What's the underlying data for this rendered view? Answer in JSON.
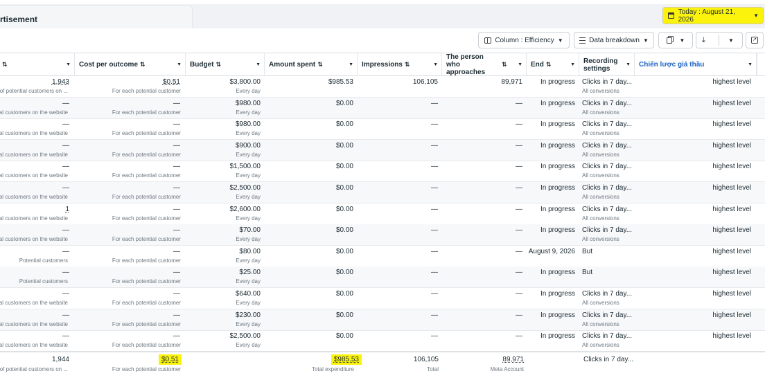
{
  "tab": {
    "title": "rtisement"
  },
  "date_button": {
    "label": "Today : August 21, 2026"
  },
  "toolbar": {
    "columns_label": "Column : Efficiency",
    "breakdown_label": "Data breakdown"
  },
  "headers": {
    "results": "",
    "cost_per_outcome": "Cost per outcome",
    "budget": "Budget",
    "amount_spent": "Amount spent",
    "impressions": "Impressions",
    "person_approaches": "The person who approaches",
    "end": "End",
    "recording": "Recording settings",
    "bid_strategy": "Chiến lược giá thầu"
  },
  "rows": [
    {
      "results": "1,943",
      "results_sub": "of potential customers on ...",
      "cpo": "$0.51",
      "cpo_sub": "For each potential customer",
      "budget": "$3,800.00",
      "budget_sub": "Every day",
      "spent": "$985.53",
      "impressions": "106,105",
      "approaches": "89,971",
      "end": "In progress",
      "recording": "Clicks in 7 day...",
      "recording_sub": "All conversions",
      "bid": "highest level"
    },
    {
      "results": "—",
      "results_sub": "al customers on the website",
      "cpo": "—",
      "cpo_sub": "For each potential customer",
      "budget": "$980.00",
      "budget_sub": "Every day",
      "spent": "$0.00",
      "impressions": "—",
      "approaches": "—",
      "end": "In progress",
      "recording": "Clicks in 7 day...",
      "recording_sub": "All conversions",
      "bid": "highest level"
    },
    {
      "results": "—",
      "results_sub": "al customers on the website",
      "cpo": "—",
      "cpo_sub": "For each potential customer",
      "budget": "$980.00",
      "budget_sub": "Every day",
      "spent": "$0.00",
      "impressions": "—",
      "approaches": "—",
      "end": "In progress",
      "recording": "Clicks in 7 day...",
      "recording_sub": "All conversions",
      "bid": "highest level"
    },
    {
      "results": "—",
      "results_sub": "al customers on the website",
      "cpo": "—",
      "cpo_sub": "For each potential customer",
      "budget": "$900.00",
      "budget_sub": "Every day",
      "spent": "$0.00",
      "impressions": "—",
      "approaches": "—",
      "end": "In progress",
      "recording": "Clicks in 7 day...",
      "recording_sub": "All conversions",
      "bid": "highest level"
    },
    {
      "results": "—",
      "results_sub": "al customers on the website",
      "cpo": "—",
      "cpo_sub": "For each potential customer",
      "budget": "$1,500.00",
      "budget_sub": "Every day",
      "spent": "$0.00",
      "impressions": "—",
      "approaches": "—",
      "end": "In progress",
      "recording": "Clicks in 7 day...",
      "recording_sub": "All conversions",
      "bid": "highest level"
    },
    {
      "results": "—",
      "results_sub": "al customers on the website",
      "cpo": "—",
      "cpo_sub": "For each potential customer",
      "budget": "$2,500.00",
      "budget_sub": "Every day",
      "spent": "$0.00",
      "impressions": "—",
      "approaches": "—",
      "end": "In progress",
      "recording": "Clicks in 7 day...",
      "recording_sub": "All conversions",
      "bid": "highest level"
    },
    {
      "results": "1",
      "results_sub": "al customers on the website",
      "cpo": "—",
      "cpo_sub": "For each potential customer",
      "budget": "$2,600.00",
      "budget_sub": "Every day",
      "spent": "$0.00",
      "impressions": "—",
      "approaches": "—",
      "end": "In progress",
      "recording": "Clicks in 7 day...",
      "recording_sub": "All conversions",
      "bid": "highest level"
    },
    {
      "results": "—",
      "results_sub": "al customers on the website",
      "cpo": "—",
      "cpo_sub": "For each potential customer",
      "budget": "$70.00",
      "budget_sub": "Every day",
      "spent": "$0.00",
      "impressions": "—",
      "approaches": "—",
      "end": "In progress",
      "recording": "Clicks in 7 day...",
      "recording_sub": "All conversions",
      "bid": "highest level"
    },
    {
      "results": "—",
      "results_sub": "Potential customers",
      "cpo": "—",
      "cpo_sub": "For each potential customer",
      "budget": "$80.00",
      "budget_sub": "Every day",
      "spent": "$0.00",
      "impressions": "—",
      "approaches": "—",
      "end": "August 9, 2026",
      "recording": "But",
      "recording_sub": "",
      "bid": "highest level"
    },
    {
      "results": "—",
      "results_sub": "Potential customers",
      "cpo": "—",
      "cpo_sub": "For each potential customer",
      "budget": "$25.00",
      "budget_sub": "Every day",
      "spent": "$0.00",
      "impressions": "—",
      "approaches": "—",
      "end": "In progress",
      "recording": "But",
      "recording_sub": "",
      "bid": "highest level"
    },
    {
      "results": "—",
      "results_sub": "al customers on the website",
      "cpo": "—",
      "cpo_sub": "For each potential customer",
      "budget": "$640.00",
      "budget_sub": "Every day",
      "spent": "$0.00",
      "impressions": "—",
      "approaches": "—",
      "end": "In progress",
      "recording": "Clicks in 7 day...",
      "recording_sub": "All conversions",
      "bid": "highest level"
    },
    {
      "results": "—",
      "results_sub": "al customers on the website",
      "cpo": "—",
      "cpo_sub": "For each potential customer",
      "budget": "$230.00",
      "budget_sub": "Every day",
      "spent": "$0.00",
      "impressions": "—",
      "approaches": "—",
      "end": "In progress",
      "recording": "Clicks in 7 day...",
      "recording_sub": "All conversions",
      "bid": "highest level"
    },
    {
      "results": "—",
      "results_sub": "al customers on the website",
      "cpo": "—",
      "cpo_sub": "For each potential customer",
      "budget": "$2,500.00",
      "budget_sub": "Every day",
      "spent": "$0.00",
      "impressions": "—",
      "approaches": "—",
      "end": "In progress",
      "recording": "Clicks in 7 day...",
      "recording_sub": "All conversions",
      "bid": "highest level"
    }
  ],
  "totals": {
    "results": "1,944",
    "results_sub": "of potential customers on ...",
    "cpo": "$0.51",
    "cpo_sub": "For each potential customer",
    "spent": "$985.53",
    "spent_sub": "Total expenditure",
    "impressions": "106,105",
    "impressions_sub": "Total",
    "approaches": "89,971",
    "approaches_sub": "Meta Account",
    "recording": "Clicks in 7 day..."
  }
}
